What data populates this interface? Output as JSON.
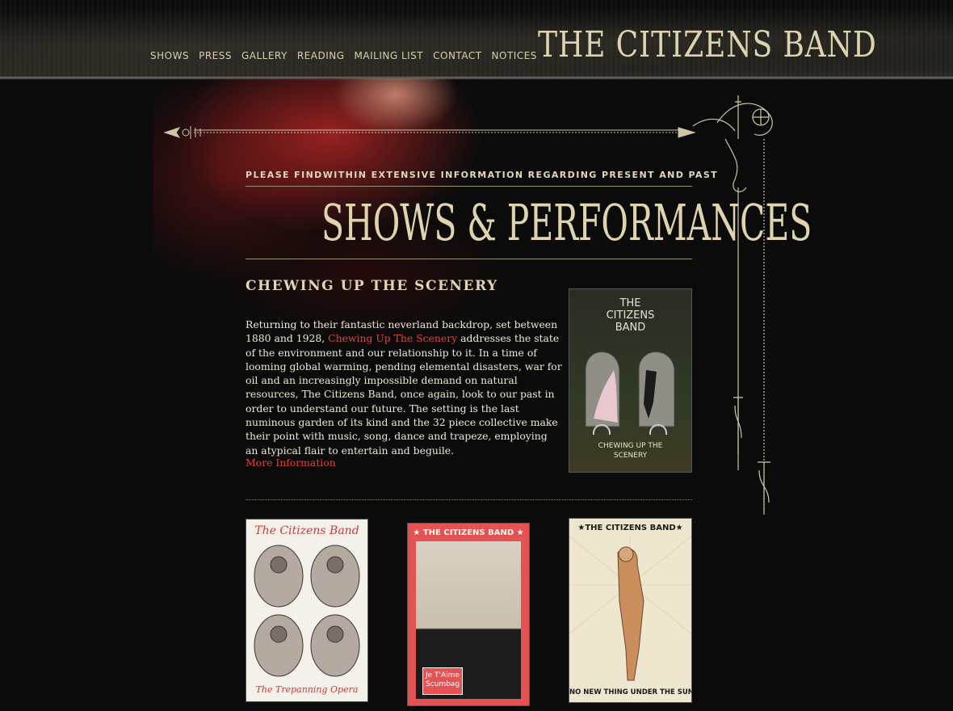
{
  "site": {
    "logo_text": "THE CITIZENS BAND"
  },
  "nav": {
    "items": [
      {
        "label": "Shows"
      },
      {
        "label": "Press"
      },
      {
        "label": "Gallery"
      },
      {
        "label": "Reading"
      },
      {
        "label": "Mailing List"
      },
      {
        "label": "Contact"
      },
      {
        "label": "Notices"
      }
    ]
  },
  "intro_text": "PLEASE FINDWITHIN EXTENSIVE INFORMATION REGARDING PRESENT AND PAST",
  "page_title": "SHOWS & PERFORMANCES",
  "feature": {
    "title": "CHEWING UP THE SCENERY",
    "desc_before": "Returning to their fantastic neverland backdrop, set between 1880 and 1928, ",
    "desc_link": "Chewing Up The Scenery",
    "desc_after": " addresses the state of the environment and our relationship to it. In a time of looming global warming, pending elemental disasters, war for oil and an increasingly impossible demand on natural resources, The Citizens Band, once again, look to our past in order to understand our future. The setting is the last numinous garden of its kind and the 32 piece collective make their point with music, song, dance and trapeze, employing an atypical flair to entertain and beguile.",
    "more_link": "More Information",
    "poster": {
      "top_line1": "THE",
      "top_line2": "CITIZENS",
      "top_line3": "BAND",
      "bottom_line1": "CHEWING UP THE",
      "bottom_line2": "SCENERY"
    }
  },
  "posters": [
    {
      "title": "The Citizens Band",
      "subtitle": "The Trepanning Opera"
    },
    {
      "title": "★ THE CITIZENS BAND ★",
      "subtitle": "Je T'Aime Scumbag"
    },
    {
      "title": "★THE CITIZENS BAND★",
      "subtitle": "NO NEW THING UNDER THE SUN"
    }
  ],
  "colors": {
    "background": "#0b0b0b",
    "cream": "#e0d6b6",
    "link_red": "#e8403a"
  }
}
